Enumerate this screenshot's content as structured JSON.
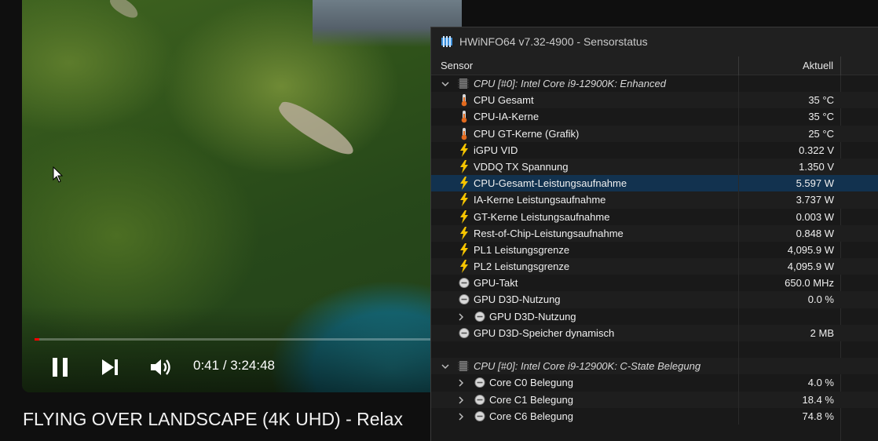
{
  "video": {
    "current_time": "0:41",
    "duration": "3:24:48",
    "time_separator": " / ",
    "progress_fraction": 0.0035,
    "title": "FLYING OVER LANDSCAPE (4K UHD) - Relax"
  },
  "hwinfo": {
    "window_title": "HWiNFO64 v7.32-4900 - Sensorstatus",
    "columns": {
      "sensor": "Sensor",
      "current": "Aktuell"
    },
    "rows": [
      {
        "type": "group",
        "label": "CPU [#0]: Intel Core i9-12900K: Enhanced",
        "value": "",
        "icon": "chip-icon",
        "expanded": true
      },
      {
        "type": "sensor",
        "label": "CPU Gesamt",
        "value": "35 °C",
        "icon": "thermometer-icon"
      },
      {
        "type": "sensor",
        "label": "CPU-IA-Kerne",
        "value": "35 °C",
        "icon": "thermometer-icon"
      },
      {
        "type": "sensor",
        "label": "CPU GT-Kerne (Grafik)",
        "value": "25 °C",
        "icon": "thermometer-icon"
      },
      {
        "type": "sensor",
        "label": "iGPU VID",
        "value": "0.322 V",
        "icon": "lightning-icon"
      },
      {
        "type": "sensor",
        "label": "VDDQ TX Spannung",
        "value": "1.350 V",
        "icon": "lightning-icon"
      },
      {
        "type": "sensor",
        "label": "CPU-Gesamt-Leistungsaufnahme",
        "value": "5.597 W",
        "icon": "lightning-icon",
        "selected": true
      },
      {
        "type": "sensor",
        "label": "IA-Kerne Leistungsaufnahme",
        "value": "3.737 W",
        "icon": "lightning-icon"
      },
      {
        "type": "sensor",
        "label": "GT-Kerne Leistungsaufnahme",
        "value": "0.003 W",
        "icon": "lightning-icon"
      },
      {
        "type": "sensor",
        "label": "Rest-of-Chip-Leistungsaufnahme",
        "value": "0.848 W",
        "icon": "lightning-icon"
      },
      {
        "type": "sensor",
        "label": "PL1 Leistungsgrenze",
        "value": "4,095.9 W",
        "icon": "lightning-icon"
      },
      {
        "type": "sensor",
        "label": "PL2 Leistungsgrenze",
        "value": "4,095.9 W",
        "icon": "lightning-icon"
      },
      {
        "type": "sensor",
        "label": "GPU-Takt",
        "value": "650.0 MHz",
        "icon": "gauge-icon"
      },
      {
        "type": "sensor",
        "label": "GPU D3D-Nutzung",
        "value": "0.0 %",
        "icon": "gauge-icon"
      },
      {
        "type": "subgroup",
        "label": "GPU D3D-Nutzung",
        "value": "",
        "icon": "gauge-icon"
      },
      {
        "type": "sensor",
        "label": "GPU D3D-Speicher dynamisch",
        "value": "2 MB",
        "icon": "gauge-icon"
      },
      {
        "type": "blank",
        "label": "",
        "value": ""
      },
      {
        "type": "group",
        "label": "CPU [#0]: Intel Core i9-12900K: C-State Belegung",
        "value": "",
        "icon": "chip-icon",
        "expanded": true
      },
      {
        "type": "subgroup",
        "label": "Core C0 Belegung",
        "value": "4.0 %",
        "icon": "gauge-icon"
      },
      {
        "type": "subgroup",
        "label": "Core C1 Belegung",
        "value": "18.4 %",
        "icon": "gauge-icon"
      },
      {
        "type": "subgroup",
        "label": "Core C6 Belegung",
        "value": "74.8 %",
        "icon": "gauge-icon"
      }
    ]
  },
  "colors": {
    "progress": "#ff0000",
    "selected_row": "#12324f",
    "lightning": "#f5c400",
    "thermometer": "#e26a1e"
  }
}
